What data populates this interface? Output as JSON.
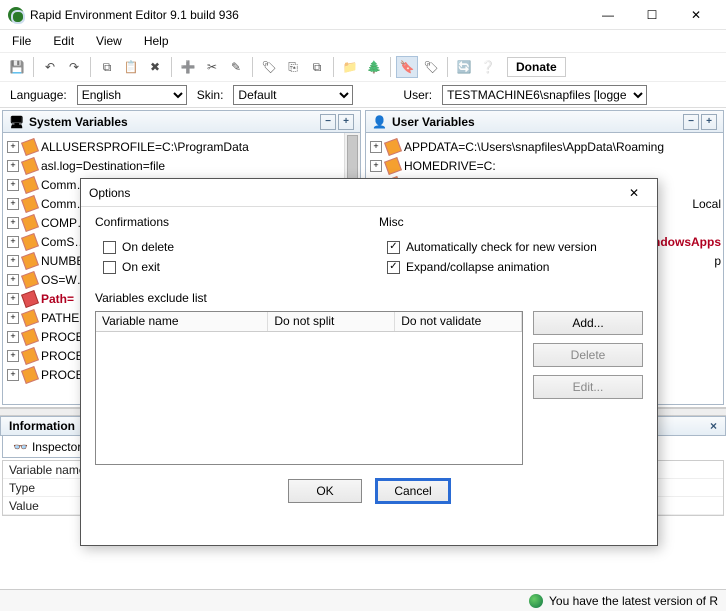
{
  "window": {
    "title": "Rapid Environment Editor 9.1 build 936",
    "min": "—",
    "max": "☐",
    "close": "✕"
  },
  "menu": {
    "file": "File",
    "edit": "Edit",
    "view": "View",
    "help": "Help"
  },
  "toolbar": {
    "donate": "Donate"
  },
  "langrow": {
    "language_label": "Language:",
    "language_value": "English",
    "skin_label": "Skin:",
    "skin_value": "Default",
    "user_label": "User:",
    "user_value": "TESTMACHINE6\\snapfiles [logge"
  },
  "panels": {
    "system": {
      "title": "System Variables",
      "items": [
        {
          "text": "ALLUSERSPROFILE=C:\\ProgramData",
          "red": false
        },
        {
          "text": "asl.log=Destination=file",
          "red": false
        },
        {
          "text": "Comm…",
          "red": false
        },
        {
          "text": "Comm…",
          "red": false
        },
        {
          "text": "COMP…",
          "red": false
        },
        {
          "text": "ComS…",
          "red": false
        },
        {
          "text": "NUMBE…",
          "red": false
        },
        {
          "text": "OS=W…",
          "red": false
        },
        {
          "text": "Path=",
          "red": true
        },
        {
          "text": "PATHE…",
          "red": false
        },
        {
          "text": "PROCE…",
          "red": false
        },
        {
          "text": "PROCE…",
          "red": false
        },
        {
          "text": "PROCE…",
          "red": false
        }
      ]
    },
    "user": {
      "title": "User Variables",
      "items": [
        {
          "text": "APPDATA=C:\\Users\\snapfiles\\AppData\\Roaming"
        },
        {
          "text": "HOMEDRIVE=C:"
        },
        {
          "text": ""
        },
        {
          "text": "Local",
          "align": "right"
        },
        {
          "text": ""
        },
        {
          "text": "sft\\WindowsApps",
          "align": "right",
          "red": true
        },
        {
          "text": "p",
          "align": "right"
        }
      ]
    }
  },
  "info": {
    "title": "Information",
    "tab": "Inspector",
    "rows": [
      {
        "k": "Variable name",
        "v": ""
      },
      {
        "k": "Type",
        "v": ""
      },
      {
        "k": "Value",
        "v": ""
      }
    ]
  },
  "status": {
    "text": "You have the latest version of R"
  },
  "dialog": {
    "title": "Options",
    "confirm_label": "Confirmations",
    "on_delete": "On delete",
    "on_delete_checked": false,
    "on_exit": "On exit",
    "on_exit_checked": false,
    "misc_label": "Misc",
    "auto_check": "Automatically check for new version",
    "auto_check_checked": true,
    "anim": "Expand/collapse animation",
    "anim_checked": true,
    "excl_label": "Variables exclude list",
    "col1": "Variable name",
    "col2": "Do not split",
    "col3": "Do not validate",
    "add": "Add...",
    "delete": "Delete",
    "edit": "Edit...",
    "ok": "OK",
    "cancel": "Cancel"
  }
}
